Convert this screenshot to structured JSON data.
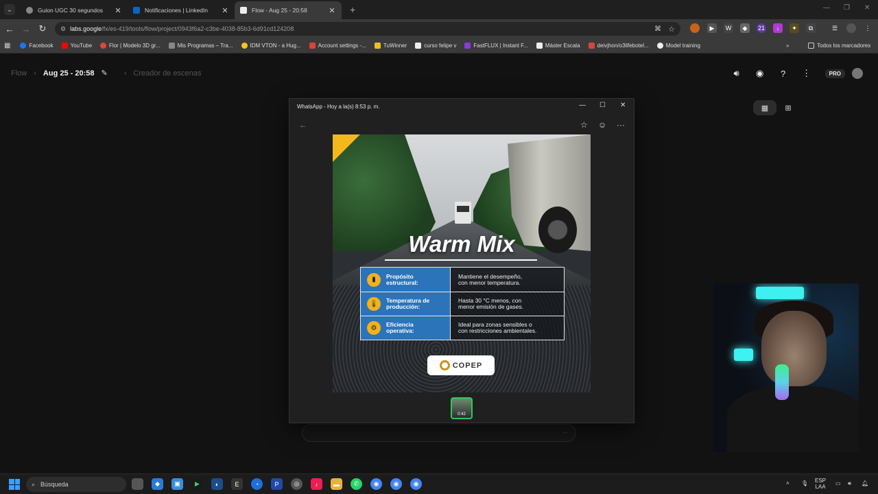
{
  "tabs": [
    {
      "label": "Guion UGC 30 segundos",
      "icon": "chatgpt-icon",
      "active": false
    },
    {
      "label": "Notificaciones | LinkedIn",
      "icon": "linkedin-icon",
      "active": false
    },
    {
      "label": "Flow - Aug 25 - 20:58",
      "icon": "page-icon",
      "active": true
    }
  ],
  "address": {
    "host": "labs.google",
    "path": "/fx/es-419/tools/flow/project/0943f6a2-c3be-4038-85b3-6d91cd124208"
  },
  "bookmarks": [
    "Facebook",
    "YouTube",
    "Flor | Modelo 3D gr...",
    "Mis Programas – Tra...",
    "IDM VTON - a Hug...",
    "Account settings -...",
    "TuWinner",
    "curso felipe v",
    "FastFLUX | Instant F...",
    "Máster Escala",
    "deivjhon/o3lifebotel...",
    "Model training"
  ],
  "bookmarks_all": "Todos los marcadores",
  "flow": {
    "crumb_root": "Flow",
    "project": "Aug 25 - 20:58",
    "scene": "Creador de escenas",
    "plan": "PRO"
  },
  "whatsapp": {
    "title": "WhatsApp - Hoy a la(s) 8:53 p. m.",
    "thumb_duration": "0:42"
  },
  "poster": {
    "headline": "Warm Mix",
    "rows": [
      {
        "label": "Propósito\nestructural:",
        "value": "Mantiene el desempeño,\ncon menor temperatura.",
        "icon": "pillar-icon"
      },
      {
        "label": "Temperatura de\nproducción:",
        "value": "Hasta 30 °C menos, con\nmenor emisión de gases.",
        "icon": "thermometer-icon"
      },
      {
        "label": "Eficiencia\noperativa:",
        "value": "Ideal para zonas sensibles o\ncon restricciones ambientales.",
        "icon": "gear-icon"
      }
    ],
    "brand": "COPEP"
  },
  "taskbar": {
    "search": "Búsqueda",
    "lang_top": "ESP",
    "lang_bottom": "LAA"
  },
  "colors": {
    "accent": "#2b74b9",
    "yellow": "#f3b21b",
    "whatsapp": "#34c759"
  }
}
